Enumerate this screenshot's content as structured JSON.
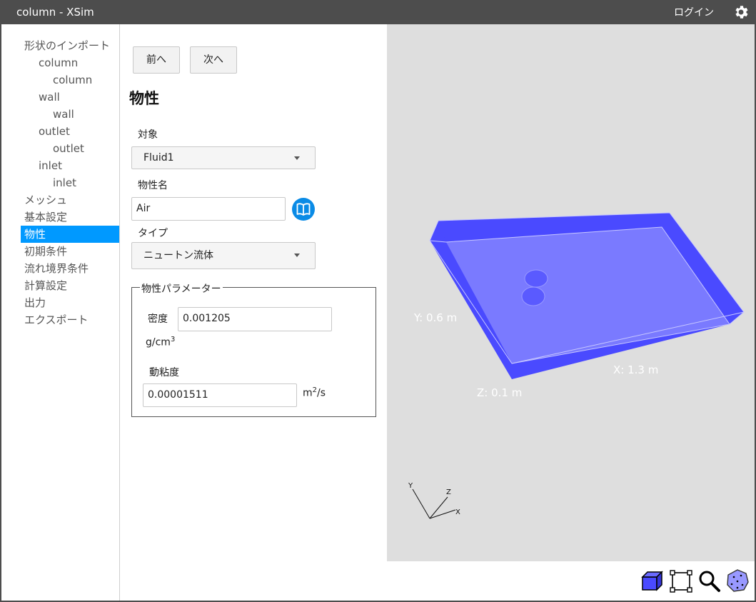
{
  "window": {
    "title": "column - XSim",
    "login_label": "ログイン"
  },
  "sidebar": {
    "items": [
      {
        "label": "形状のインポート"
      },
      {
        "label": "column"
      },
      {
        "label": "column"
      },
      {
        "label": "wall"
      },
      {
        "label": "wall"
      },
      {
        "label": "outlet"
      },
      {
        "label": "outlet"
      },
      {
        "label": "inlet"
      },
      {
        "label": "inlet"
      },
      {
        "label": "メッシュ"
      },
      {
        "label": "基本設定"
      },
      {
        "label": "物性",
        "active": true
      },
      {
        "label": "初期条件"
      },
      {
        "label": "流れ境界条件"
      },
      {
        "label": "計算設定"
      },
      {
        "label": "出力"
      },
      {
        "label": "エクスポート"
      }
    ]
  },
  "form": {
    "prev_label": "前へ",
    "next_label": "次へ",
    "title": "物性",
    "target_label": "対象",
    "target_value": "Fluid1",
    "material_name_label": "物性名",
    "material_name_value": "Air",
    "type_label": "タイプ",
    "type_value": "ニュートン流体",
    "params_legend": "物性パラメーター",
    "density_label": "密度",
    "density_value": "0.001205",
    "density_unit": "g/cm",
    "density_unit_exp": "3",
    "viscosity_label": "動粘度",
    "viscosity_value": "0.00001511",
    "viscosity_unit": "m",
    "viscosity_unit_exp": "2",
    "viscosity_unit_tail": "/s"
  },
  "viewport": {
    "dim_x": "X: 1.3 m",
    "dim_y": "Y: 0.6 m",
    "dim_z": "Z: 0.1 m",
    "axis_x": "X",
    "axis_y": "Y",
    "axis_z": "Z",
    "colors": {
      "background": "#dedede",
      "body": "#5858ff",
      "face": "#7a7aff"
    }
  },
  "toolbar": {
    "icons": [
      "solid-view-icon",
      "fit-view-icon",
      "zoom-icon",
      "point-cloud-icon"
    ]
  },
  "colors": {
    "titlebar": "#4d4d4d",
    "accent": "#0099ff",
    "info_button": "#0a8be6"
  }
}
